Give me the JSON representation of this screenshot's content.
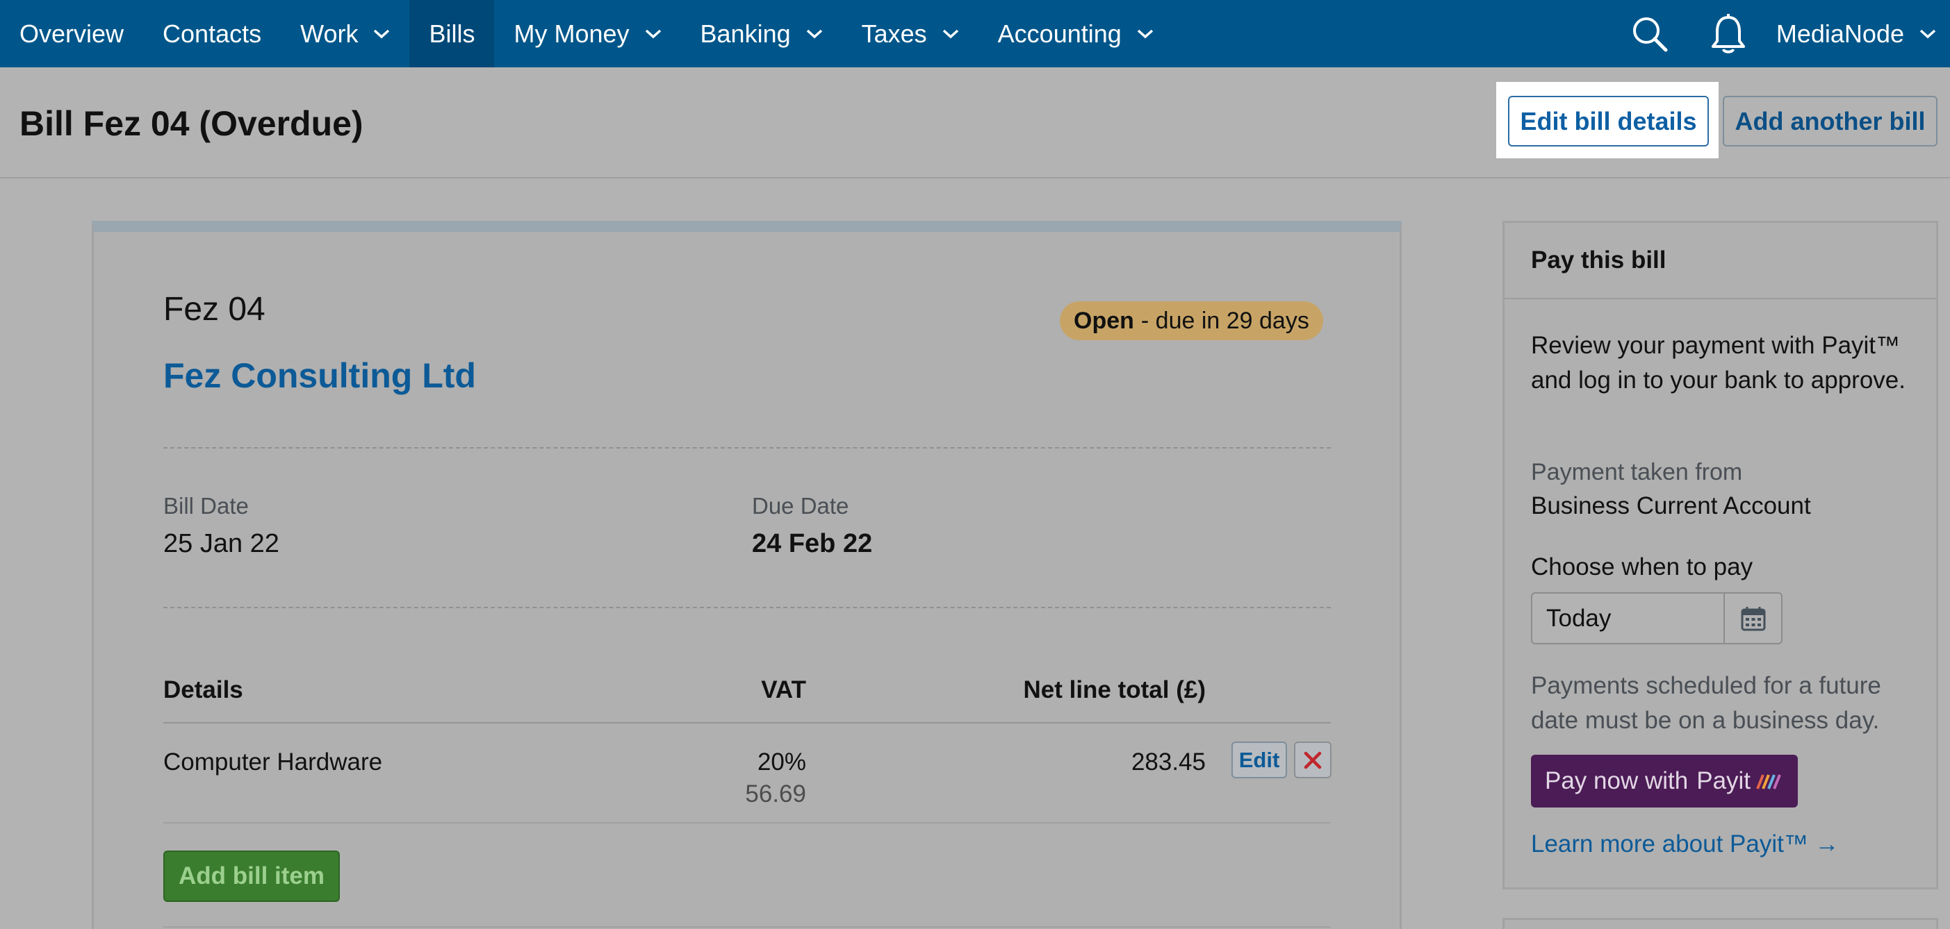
{
  "nav": {
    "items": [
      {
        "label": "Overview",
        "dropdown": false,
        "active": false
      },
      {
        "label": "Contacts",
        "dropdown": false,
        "active": false
      },
      {
        "label": "Work",
        "dropdown": true,
        "active": false
      },
      {
        "label": "Bills",
        "dropdown": false,
        "active": true
      },
      {
        "label": "My Money",
        "dropdown": true,
        "active": false
      },
      {
        "label": "Banking",
        "dropdown": true,
        "active": false
      },
      {
        "label": "Taxes",
        "dropdown": true,
        "active": false
      },
      {
        "label": "Accounting",
        "dropdown": true,
        "active": false
      }
    ],
    "account_name": "MediaNode"
  },
  "header": {
    "title": "Bill Fez 04 (Overdue)",
    "edit_button": "Edit bill details",
    "add_button": "Add another bill"
  },
  "bill": {
    "reference": "Fez 04",
    "status_label": "Open",
    "status_detail": "- due in 29 days",
    "supplier": "Fez Consulting Ltd",
    "bill_date_label": "Bill Date",
    "bill_date": "25 Jan 22",
    "due_date_label": "Due Date",
    "due_date": "24 Feb 22",
    "table": {
      "headers": {
        "details": "Details",
        "vat": "VAT",
        "net": "Net line total (£)"
      },
      "rows": [
        {
          "details": "Computer Hardware",
          "vat_rate": "20%",
          "vat_amount": "56.69",
          "net_total": "283.45",
          "edit_label": "Edit"
        }
      ]
    },
    "add_item_button": "Add bill item"
  },
  "pay_panel": {
    "title": "Pay this bill",
    "intro": "Review your payment with Payit™ and log in to your bank to approve.",
    "taken_from_label": "Payment taken from",
    "account": "Business Current Account",
    "choose_label": "Choose when to pay",
    "date_value": "Today",
    "note": "Payments scheduled for a future date must be on a business day.",
    "pay_button": "Pay now with",
    "pay_brand": "Payit",
    "learn_more": "Learn more about Payit™ →"
  },
  "colors": {
    "nav_bg": "#00568a",
    "link": "#0c5a97",
    "status_badge": "#c7a466",
    "add_item_green": "#3a7d2e",
    "payit_purple": "#4b1c55"
  }
}
